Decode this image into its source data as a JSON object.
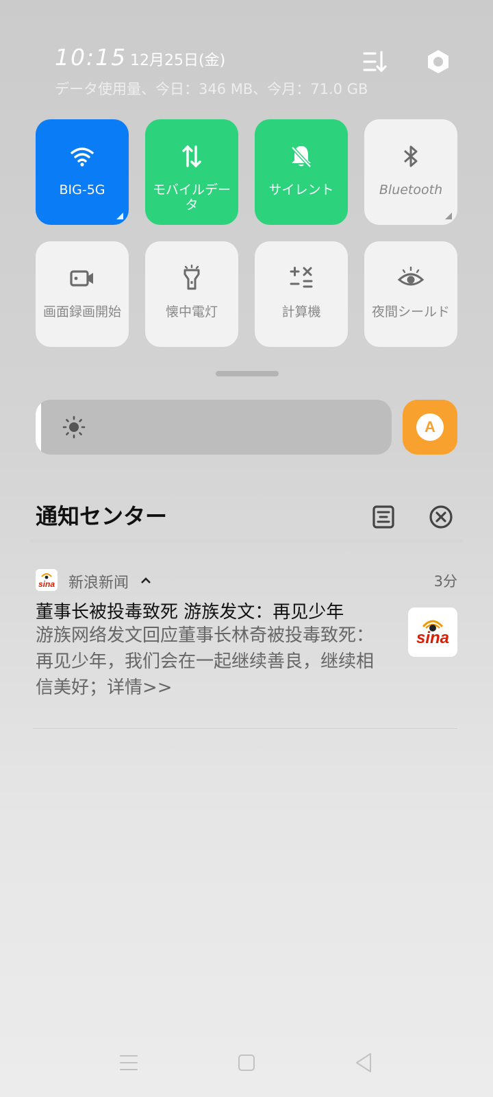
{
  "status": {
    "time": "10:15",
    "date": "12月25日(金)",
    "data_usage": "データ使用量、今日：346 MB、今月：71.0 GB"
  },
  "tiles": [
    {
      "label": "BIG-5G",
      "icon": "wifi-icon",
      "color": "#0a7cf5",
      "active": true
    },
    {
      "label": "モバイルデータ",
      "icon": "mobile-data-icon",
      "color": "#2dd27d",
      "active": true
    },
    {
      "label": "サイレント",
      "icon": "silent-bell-icon",
      "color": "#2dd27d",
      "active": true
    },
    {
      "label": "Bluetooth",
      "icon": "bluetooth-icon",
      "active": false
    },
    {
      "label": "画面録画開始",
      "icon": "screen-record-icon",
      "active": false
    },
    {
      "label": "懐中電灯",
      "icon": "flashlight-icon",
      "active": false
    },
    {
      "label": "計算機",
      "icon": "calculator-icon",
      "active": false
    },
    {
      "label": "夜間シールド",
      "icon": "eye-icon",
      "active": false
    }
  ],
  "brightness": {
    "level": 0.015,
    "auto_label": "A",
    "auto_color": "#f9a12e"
  },
  "notification_center": {
    "title": "通知センター"
  },
  "notification": {
    "app_name": "新浪新闻",
    "time": "3分",
    "title": "董事长被投毒致死 游族发文：再见少年",
    "body": "游族网络发文回应董事长林奇被投毒致死：再见少年，我们会在一起继续善良，继续相信美好；详情>>",
    "brand_color": "#d81e06"
  }
}
